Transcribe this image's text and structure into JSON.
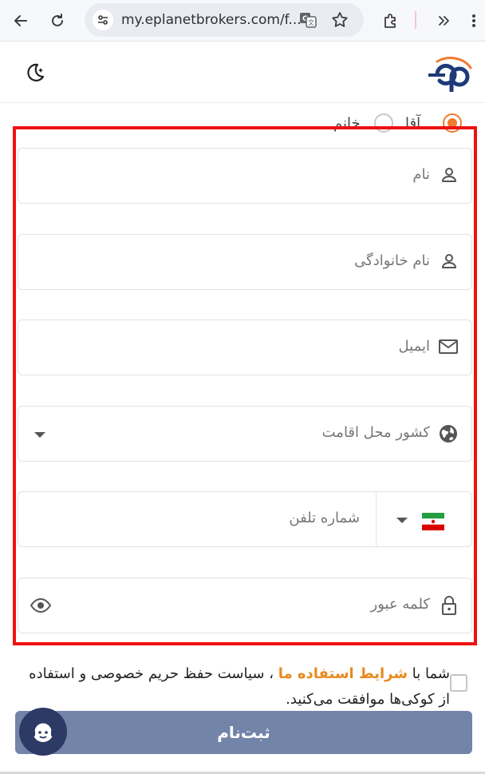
{
  "browser": {
    "url": "my.eplanetbrokers.com/f...",
    "icons": [
      "back-arrow-icon",
      "reload-icon",
      "site-settings-icon",
      "translate-icon",
      "star-icon",
      "extensions-icon",
      "chevron-right-icon"
    ]
  },
  "header": {
    "logo_text": "ep",
    "theme_toggle_icon": "moon-star-icon"
  },
  "gender": {
    "options": [
      {
        "label": "آقا",
        "selected": true
      },
      {
        "label": "خانم",
        "selected": false
      }
    ]
  },
  "form": {
    "first_name_placeholder": "نام",
    "last_name_placeholder": "نام خانوادگی",
    "email_placeholder": "ایمیل",
    "country_placeholder": "کشور محل اقامت",
    "phone_placeholder": "شماره تلفن",
    "password_placeholder": "کلمه عبور",
    "phone_country_flag": "iran-flag"
  },
  "consent": {
    "prefix": "شما با ",
    "link": "شرایط استفاده ما",
    "suffix": " ، سیاست حفظ حریم خصوصی و استفاده از کوکی‌ها موافقت می‌کنید."
  },
  "submit": {
    "label": "ثبت‌نام"
  },
  "colors": {
    "accent": "#f07b2e",
    "submit_bg": "#7284a8",
    "highlight": "#ee1111",
    "logo_blue": "#1e3a78"
  }
}
